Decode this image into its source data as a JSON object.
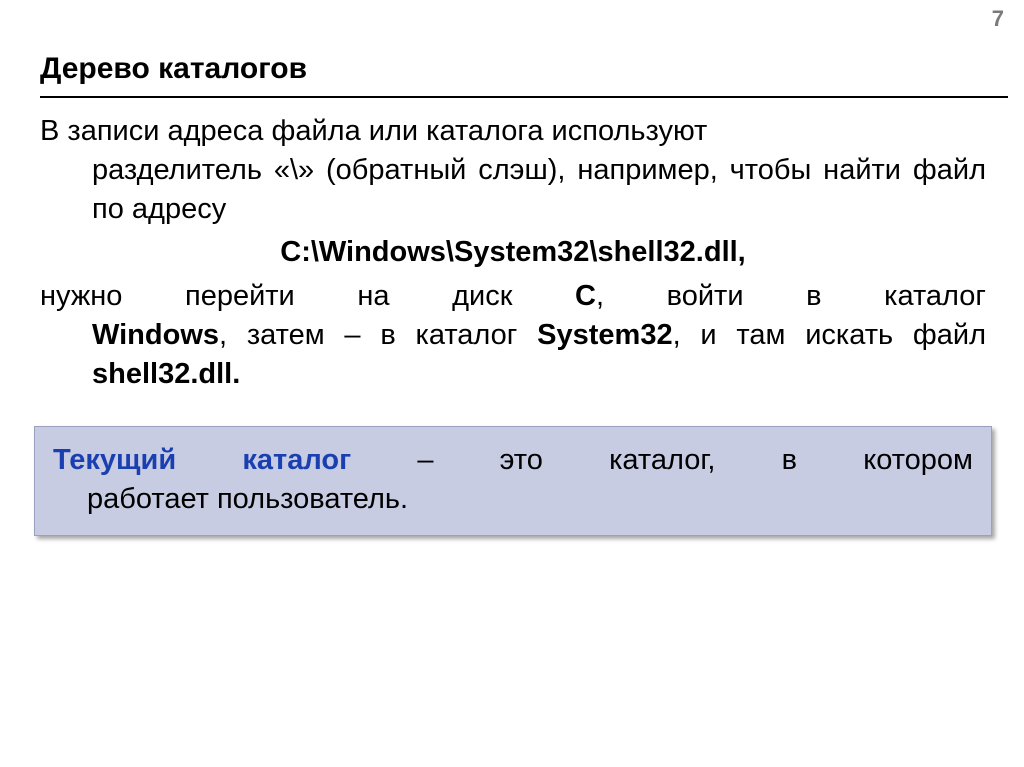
{
  "page_number": "7",
  "title": "Дерево каталогов",
  "body": {
    "p1_line1": "В записи адреса файла или каталога используют",
    "p1_rest": "разделитель «\\» (обратный слэш), например, чтобы найти файл по адресу",
    "path": "С:\\Windows\\System32\\shell32.dll,",
    "p2_lead": "нужно перейти на диск ",
    "p2_C": "С",
    "p2_after_c": ", войти в каталог",
    "p2_windows": "Windows",
    "p2_mid1": ", затем – в каталог ",
    "p2_system32": "System32",
    "p2_mid2": ", и там искать файл ",
    "p2_shell": "shell32.dll."
  },
  "callout": {
    "term": "Текущий каталог",
    "line1_rest": " – это каталог, в котором",
    "line2": "работает пользователь."
  }
}
